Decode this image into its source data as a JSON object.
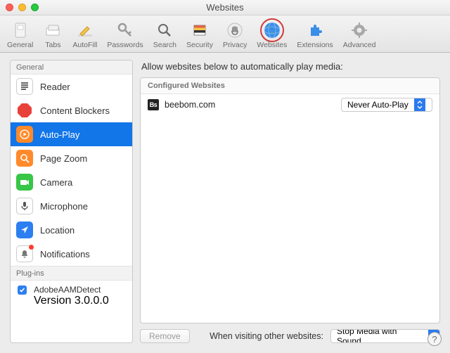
{
  "window": {
    "title": "Websites"
  },
  "toolbar": [
    {
      "label": "General",
      "icon": "switch"
    },
    {
      "label": "Tabs",
      "icon": "tabs"
    },
    {
      "label": "AutoFill",
      "icon": "pencil"
    },
    {
      "label": "Passwords",
      "icon": "key"
    },
    {
      "label": "Search",
      "icon": "magnify"
    },
    {
      "label": "Security",
      "icon": "warning"
    },
    {
      "label": "Privacy",
      "icon": "hand"
    },
    {
      "label": "Websites",
      "icon": "globe",
      "highlighted": true
    },
    {
      "label": "Extensions",
      "icon": "puzzle"
    },
    {
      "label": "Advanced",
      "icon": "gear"
    }
  ],
  "sidebar": {
    "general_label": "General",
    "items": [
      {
        "label": "Reader",
        "icon": "reader"
      },
      {
        "label": "Content Blockers",
        "icon": "stop"
      },
      {
        "label": "Auto-Play",
        "icon": "play",
        "selected": true
      },
      {
        "label": "Page Zoom",
        "icon": "zoom"
      },
      {
        "label": "Camera",
        "icon": "camera"
      },
      {
        "label": "Microphone",
        "icon": "mic"
      },
      {
        "label": "Location",
        "icon": "location"
      },
      {
        "label": "Notifications",
        "icon": "bell",
        "dot": true
      }
    ],
    "plugins_label": "Plug-ins",
    "plugins": [
      {
        "label": "AdobeAAMDetect",
        "version": "Version 3.0.0.0",
        "checked": true
      }
    ]
  },
  "main": {
    "heading": "Allow websites below to automatically play media:",
    "list_header": "Configured Websites",
    "rows": [
      {
        "favicon": "Bs",
        "site": "beebom.com",
        "setting": "Never Auto-Play"
      }
    ],
    "remove_label": "Remove",
    "other_label": "When visiting other websites:",
    "other_value": "Stop Media with Sound"
  }
}
